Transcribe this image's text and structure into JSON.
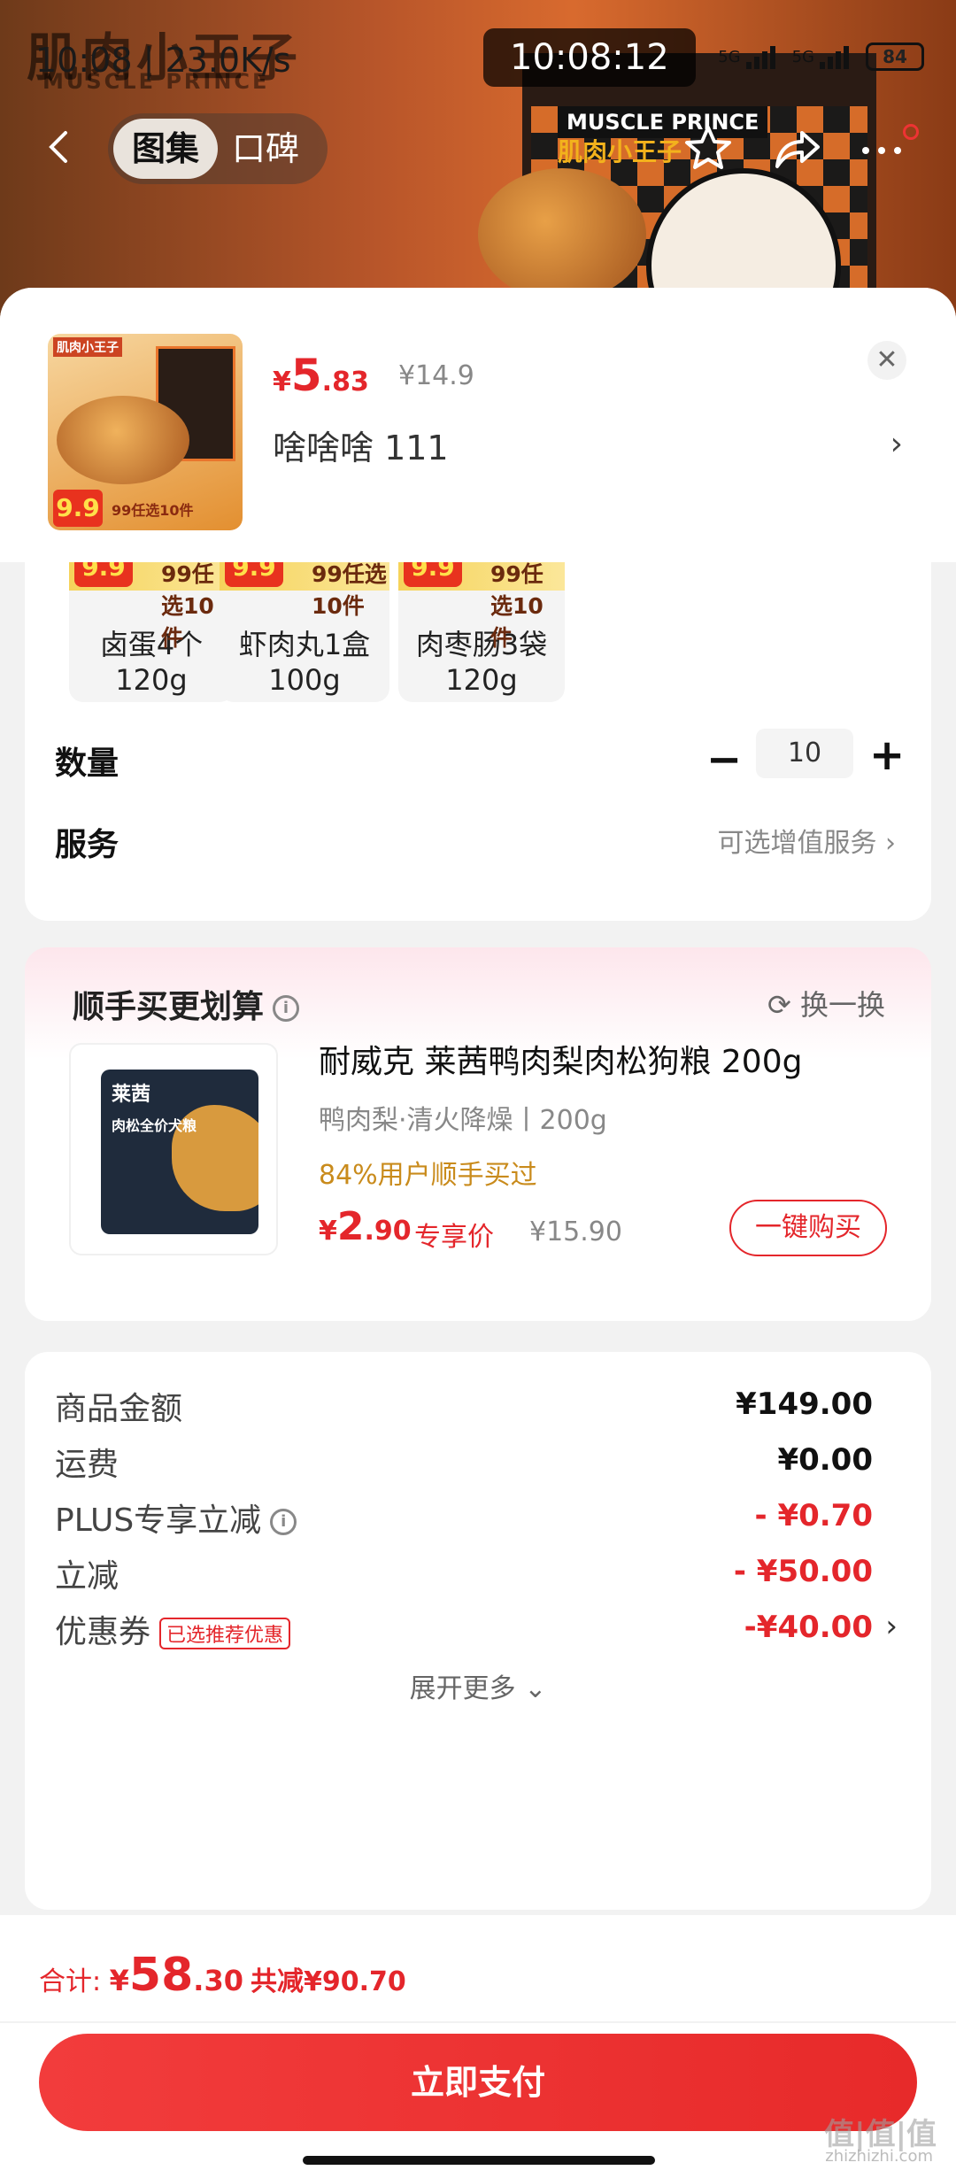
{
  "status_bar": {
    "left_text": "10:08 | 23.0K/s",
    "clock": "10:08:12",
    "network_1": "5G",
    "network_2": "5G",
    "battery": "84"
  },
  "hero": {
    "logo_cn": "肌肉小王子",
    "logo_en": "MUSCLE PRINCE",
    "brand_en": "MUSCLE PRINCE",
    "brand_cn": "肌肉小王子"
  },
  "nav": {
    "tab_gallery": "图集",
    "tab_reviews": "口碑"
  },
  "product": {
    "thumb_brand": "肌肉小王子",
    "thumb_badge": "9.9",
    "thumb_tag": "99任选10件",
    "price_symbol": "¥",
    "price_int": "5",
    "price_dec": ".83",
    "price_old": "¥14.9",
    "variant": "啥啥啥  111",
    "close_icon": "close-icon",
    "chevron": "›"
  },
  "options": [
    {
      "badge": "9.9",
      "tag": "99任选10件",
      "label": "卤蛋4个 120g"
    },
    {
      "badge": "9.9",
      "tag": "99任选10件",
      "label": "虾肉丸1盒 100g"
    },
    {
      "badge": "9.9",
      "tag": "99任选10件",
      "label": "肉枣肠3袋 120g"
    }
  ],
  "quantity": {
    "label": "数量",
    "minus": "−",
    "value": "10",
    "plus": "+"
  },
  "service": {
    "label": "服务",
    "hint": "可选增值服务 ›"
  },
  "addon": {
    "title": "顺手买更划算",
    "info_icon": "i",
    "swap": "⟳ 换一换",
    "bag_brand": "莱茜",
    "bag_title": "肉松全价犬粮",
    "name": "耐威克 莱茜鸭肉梨肉松狗粮 200g",
    "spec": "鸭肉梨·清火降燥丨200g",
    "percent": "84%用户顺手买过",
    "price_symbol": "¥",
    "price_int": "2",
    "price_dec": ".90",
    "exclusive": "专享价",
    "old_price": "¥15.90",
    "buy_button": "一键购买"
  },
  "summary": {
    "rows": [
      {
        "label": "商品金额",
        "value": "¥149.00"
      },
      {
        "label": "运费",
        "value": "¥0.00"
      },
      {
        "label": "PLUS专享立减",
        "value": "- ¥0.70"
      },
      {
        "label": "立减",
        "value": "- ¥50.00"
      },
      {
        "label": "优惠券",
        "tag": "已选推荐优惠",
        "value": "-¥40.00"
      }
    ],
    "info_icon": "i",
    "expand": "展开更多 ⌄"
  },
  "footer": {
    "total_label": "合计: ",
    "total_symbol": "¥",
    "total_int": "58",
    "total_dec": ".30",
    "saved": "共减¥90.70",
    "pay_button": "立即支付",
    "watermark": "值|值|值",
    "watermark_url": "zhizhizhi.com"
  },
  "colors": {
    "accent_red": "#e4262b",
    "gold": "#c98b1c"
  }
}
